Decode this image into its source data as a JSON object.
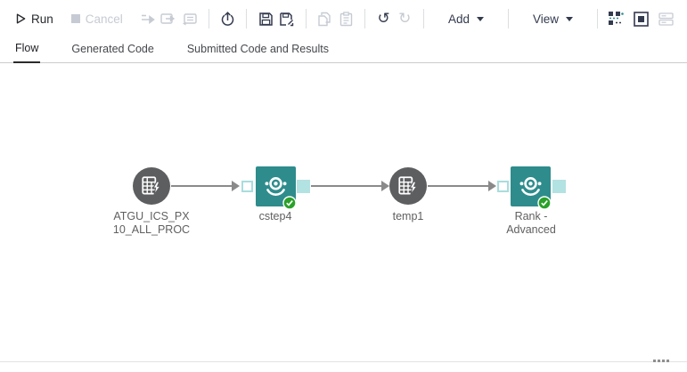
{
  "toolbar": {
    "run_label": "Run",
    "cancel_label": "Cancel",
    "add_label": "Add",
    "view_label": "View"
  },
  "tabs": [
    {
      "label": "Flow",
      "active": true
    },
    {
      "label": "Generated Code",
      "active": false
    },
    {
      "label": "Submitted Code and Results",
      "active": false
    }
  ],
  "flow": {
    "nodes": [
      {
        "type": "table",
        "label": "ATGU_ICS_PX 10_ALL_PROC",
        "status": "none"
      },
      {
        "type": "step",
        "label": "cstep4",
        "status": "success"
      },
      {
        "type": "table",
        "label": "temp1",
        "status": "none"
      },
      {
        "type": "step",
        "label": "Rank - Advanced",
        "status": "success"
      }
    ],
    "connections": [
      {
        "from": "ATGU_ICS_PX 10_ALL_PROC",
        "to": "cstep4"
      },
      {
        "from": "cstep4",
        "to": "temp1"
      },
      {
        "from": "temp1",
        "to": "Rank - Advanced"
      }
    ]
  },
  "colors": {
    "step_teal": "#2e8c8c",
    "port_teal": "#b3e2e2",
    "table_gray": "#5d5e60",
    "connector_gray": "#8a8a8a",
    "success_green": "#2aa12a",
    "toolbar_ink": "#343a4e",
    "disabled_gray": "#c6cbd3"
  }
}
